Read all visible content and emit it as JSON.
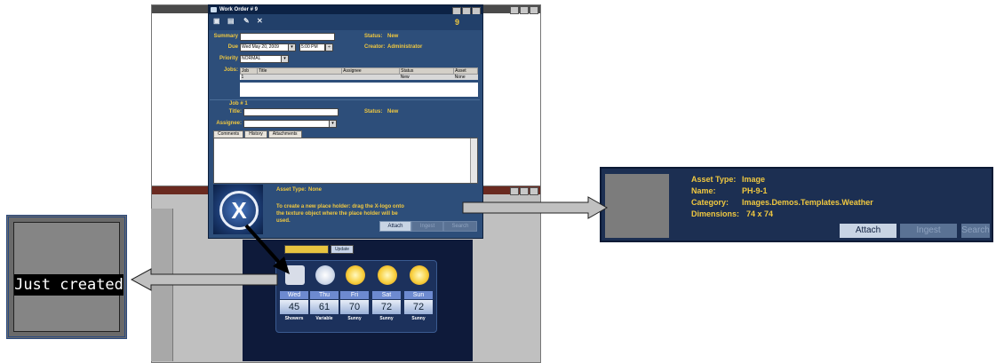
{
  "work_order": {
    "window_title": "Work Order # 9",
    "number": "9",
    "summary_label": "Summary",
    "summary_value": "",
    "due_label": "Due",
    "due_date": "Wed May 20, 2009",
    "due_time": "5:00 PM",
    "priority_label": "Priority",
    "priority_value": "NORMAL",
    "status_label": "Status:",
    "status_value": "New",
    "creator_label": "Creator:",
    "creator_value": "Administrator",
    "jobs_label": "Jobs:",
    "jobs_columns": [
      "Job",
      "Title",
      "Assignee",
      "Status",
      "Asset"
    ],
    "jobs_rows": [
      [
        "1",
        "",
        "",
        "New",
        "None"
      ]
    ],
    "job_header": "Job # 1",
    "job_title_label": "Title:",
    "job_status_label": "Status:",
    "job_status_value": "New",
    "assignee_label": "Assignee:",
    "tabs": [
      "Comments",
      "History",
      "Attachments"
    ],
    "asset_type_label": "Asset Type:",
    "asset_type_value": "None",
    "help_text": "To create a new place holder: drag the X-logo onto the texture object where the place holder will be used.",
    "buttons": {
      "attach": "Attach",
      "ingest": "Ingest",
      "search": "Search"
    }
  },
  "weather": {
    "update_label": "Update",
    "days": [
      {
        "name": "Wed",
        "temp": "45",
        "cond": "Showers"
      },
      {
        "name": "Thu",
        "temp": "61",
        "cond": "Variable"
      },
      {
        "name": "Fri",
        "temp": "70",
        "cond": "Sunny"
      },
      {
        "name": "Sat",
        "temp": "72",
        "cond": "Sunny"
      },
      {
        "name": "Sun",
        "temp": "72",
        "cond": "Sunny"
      }
    ]
  },
  "just_created": {
    "label": "Just created"
  },
  "asset_panel": {
    "asset_type_label": "Asset Type:",
    "asset_type_value": "Image",
    "name_label": "Name:",
    "name_value": "PH-9-1",
    "category_label": "Category:",
    "category_value": "Images.Demos.Templates.Weather",
    "dimensions_label": "Dimensions:",
    "dimensions_value": "74 x 74",
    "buttons": {
      "attach": "Attach",
      "ingest": "Ingest",
      "search": "Search"
    }
  },
  "colors": {
    "accent": "#f0c840",
    "dialog_bg": "#2d4e7a",
    "title_bar": "#0c2245"
  }
}
